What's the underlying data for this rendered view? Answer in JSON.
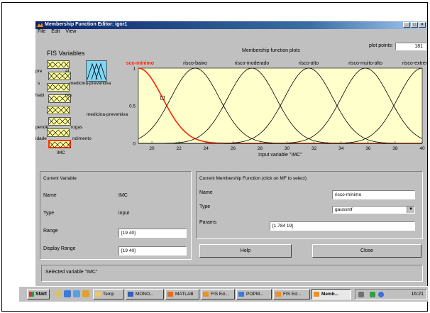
{
  "window": {
    "title": "Membership Function Editor: igor1"
  },
  "menu": [
    "File",
    "Edit",
    "View"
  ],
  "fis": {
    "title": "FIS Variables",
    "inputs": [
      "previdencia-social",
      "saude",
      "habitos-alimentares",
      "",
      "",
      "dependencia-de-drogas",
      "sedentarismo-atividade",
      "IMC"
    ],
    "visible_labels": [
      "pre",
      "al",
      "s",
      "medicina-preventiva",
      "habi",
      "res",
      "pendê",
      "rogas",
      "idade",
      "ndimento",
      "IMC"
    ],
    "output": "medicina-preventiva"
  },
  "plot": {
    "title": "Membership function plots",
    "plot_points_label": "plot points:",
    "plot_points": "181",
    "xlabel": "input variable \"IMC\"",
    "xticks": [
      "20",
      "22",
      "24",
      "26",
      "28",
      "30",
      "32",
      "34",
      "36",
      "38",
      "40"
    ],
    "yticks": [
      "0",
      "0.5",
      "1"
    ]
  },
  "chart_data": {
    "type": "line",
    "title": "Membership function plots",
    "xlabel": "input variable \"IMC\"",
    "ylabel": "",
    "xlim": [
      19,
      40
    ],
    "ylim": [
      0,
      1
    ],
    "series": [
      {
        "name": "risco-mínimo",
        "mf": "gaussmf",
        "sigma": 1.784,
        "center": 19,
        "selected": true
      },
      {
        "name": "risco-baixo",
        "mf": "gaussmf",
        "sigma": 1.784,
        "center": 23.2
      },
      {
        "name": "risco-moderado",
        "mf": "gaussmf",
        "sigma": 1.784,
        "center": 27.4
      },
      {
        "name": "risco-alto",
        "mf": "gaussmf",
        "sigma": 1.784,
        "center": 31.6
      },
      {
        "name": "risco-muito-alto",
        "mf": "gaussmf",
        "sigma": 1.784,
        "center": 35.8
      },
      {
        "name": "risco-extremamente-alto",
        "mf": "gaussmf",
        "sigma": 1.784,
        "center": 40
      }
    ]
  },
  "mf_labels": [
    "risco-mínimo",
    "risco-baixo",
    "risco-moderado",
    "risco-alto",
    "risco-muito-alto",
    "risco-extremamen"
  ],
  "current_variable": {
    "header": "Current Variable",
    "name_label": "Name",
    "name_value": "IMC",
    "type_label": "Type",
    "type_value": "input",
    "range_label": "Range",
    "range_value": "[19 40]",
    "display_label": "Display Range",
    "display_value": "[19 40]"
  },
  "current_mf": {
    "header": "Current Membership Function (click on MF to select)",
    "name_label": "Name",
    "name_value": "risco-mínimo",
    "type_label": "Type",
    "type_value": "gaussmf",
    "params_label": "Params",
    "params_value": "[1.784 19]"
  },
  "buttons": {
    "help": "Help",
    "close": "Close"
  },
  "status": "Selected variable \"IMC\"",
  "taskbar": {
    "start": "Start",
    "items": [
      "Temp",
      "MONO...",
      "MATLAB",
      "FIS Ed...",
      "POPM...",
      "FIS Ed...",
      "Memb..."
    ],
    "clock": "16:21"
  },
  "colors": {
    "plot_bg": "#ffffcc",
    "selected": "#ff2200",
    "curve": "#000000",
    "titlebar": "#0a246a"
  }
}
